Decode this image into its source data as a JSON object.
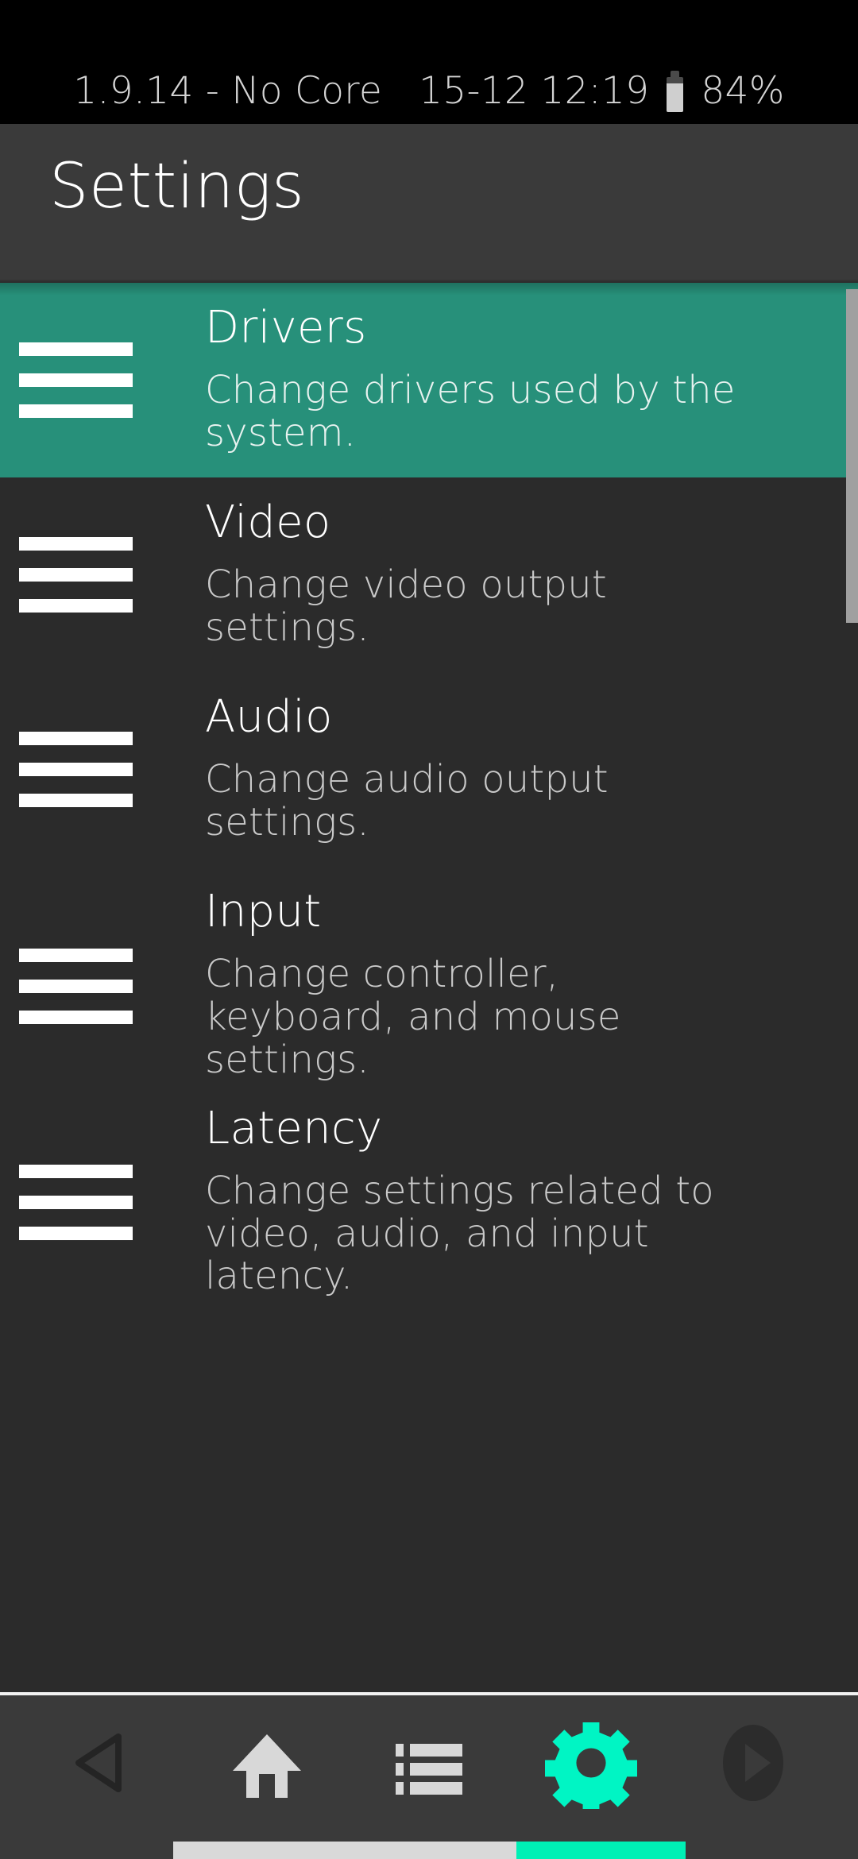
{
  "status_bar": {
    "version_text": "1.9.14 - No Core",
    "datetime": "15-12 12:19",
    "battery_percent": "84%",
    "battery_icon": "battery-icon"
  },
  "header": {
    "title": "Settings"
  },
  "colors": {
    "selected_row": "#27907a",
    "background": "#2b2b2b",
    "header_bg": "#3a3a3a",
    "accent_nav": "#00f0b5",
    "scrollbar": "#a0a0a0",
    "status_bar_bg": "#000000",
    "text_primary": "#ffffff",
    "text_secondary": "#c9c9c9"
  },
  "list": {
    "items": [
      {
        "icon": "hamburger-menu-icon",
        "title": "Drivers",
        "subtitle": "Change drivers used by the system.",
        "selected": true
      },
      {
        "icon": "hamburger-menu-icon",
        "title": "Video",
        "subtitle": "Change video output settings.",
        "selected": false
      },
      {
        "icon": "hamburger-menu-icon",
        "title": "Audio",
        "subtitle": "Change audio output settings.",
        "selected": false
      },
      {
        "icon": "hamburger-menu-icon",
        "title": "Input",
        "subtitle": "Change controller, keyboard, and mouse settings.",
        "selected": false
      },
      {
        "icon": "hamburger-menu-icon",
        "title": "Latency",
        "subtitle": "Change settings related to video, audio, and input latency.",
        "selected": false
      }
    ]
  },
  "nav_bar": {
    "buttons": [
      {
        "icon": "back-triangle-icon",
        "label": "Back",
        "active": false
      },
      {
        "icon": "home-icon",
        "label": "Home",
        "active": false
      },
      {
        "icon": "list-icon",
        "label": "Menu",
        "active": false
      },
      {
        "icon": "gear-icon",
        "label": "Settings",
        "active": true
      },
      {
        "icon": "play-forward-icon",
        "label": "Resume",
        "active": false
      }
    ]
  }
}
